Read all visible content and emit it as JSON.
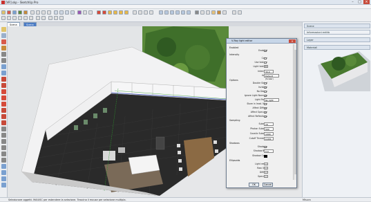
{
  "window": {
    "title": "[VR].skp - SketchUp Pro",
    "controls": [
      "minimize",
      "maximize",
      "close"
    ]
  },
  "menu": [
    "File",
    "Modifica",
    "Visualizza",
    "Telecamera",
    "Disegna",
    "Strumenti",
    "Finestra",
    "Estensioni",
    "Guida"
  ],
  "scene_tabs": [
    {
      "label": "Scena 1",
      "active": true
    },
    {
      "label": "Scena 2",
      "active": false
    }
  ],
  "right_panel": {
    "trays": [
      "Scene",
      "Informazioni entità",
      "Layer",
      "Materiali"
    ]
  },
  "status": {
    "message": "Selezionare oggetti. MAIUSC per estendere la selezione. Trascina il mouse per selezione multipla.",
    "measurements_label": "Misura"
  },
  "dialog": {
    "title": "V-Ray light editor",
    "sections": {
      "enabled": "Enabled",
      "intensity": "Intensity",
      "options": "Options",
      "sampling": "Sampling",
      "shadows": "Shadows",
      "ellipsoids": "Ellipsoids"
    },
    "rows": {
      "enabled": {
        "label": "Enabled",
        "checked": true
      },
      "color": {
        "label": "Color"
      },
      "use_texture": {
        "label": "Use texture",
        "checked": false
      },
      "light_texture": {
        "label": "Light texture",
        "button": "m"
      },
      "intensity": {
        "label": "Intensity",
        "value": "30,0"
      },
      "units": {
        "label": "Units",
        "value": "Default (Scalar)"
      },
      "double_sided": {
        "label": "Double Sided",
        "checked": false
      },
      "invisible": {
        "label": "Invisible",
        "checked": true
      },
      "no_decay": {
        "label": "No Decay",
        "checked": false
      },
      "ignore_normals": {
        "label": "Ignore Light Normals",
        "checked": true
      },
      "light_portal": {
        "label": "Light Portal",
        "value": "No light"
      },
      "store_irradiance": {
        "label": "Store in Irrad. Map",
        "checked": false
      },
      "affect_diffuse": {
        "label": "Affect Diffuse",
        "checked": true
      },
      "affect_specular": {
        "label": "Affect Specular",
        "checked": true
      },
      "affect_reflections": {
        "label": "Affect Reflections",
        "checked": true
      },
      "subdivs": {
        "label": "Subdivs",
        "value": "16"
      },
      "photon_subdivs": {
        "label": "Photon Subdivs",
        "value": "500"
      },
      "caustic_subdivs": {
        "label": "Caustic Subdivs",
        "value": "1000"
      },
      "cutoff": {
        "label": "Cutoff Threshold",
        "value": "0,001"
      },
      "shadows_on": {
        "label": "Shadows",
        "checked": true
      },
      "shadow_bias": {
        "label": "Shadow Bias",
        "value": "0,0"
      },
      "shadow_color": {
        "label": "Shadow Color"
      },
      "light_result": {
        "label": "Light result",
        "button": "..."
      },
      "raw_light": {
        "label": "Raw light",
        "button": "..."
      },
      "diffuse": {
        "label": "Diffuse",
        "button": "..."
      },
      "specular": {
        "label": "Specular",
        "button": "..."
      }
    },
    "buttons": {
      "ok": "OK",
      "cancel": "Cancel"
    }
  },
  "colors": {
    "accent": "#2f5fa5",
    "floor": "#2a2a2a",
    "grass": "#5a8a3a",
    "wall": "#e8e8ea"
  }
}
